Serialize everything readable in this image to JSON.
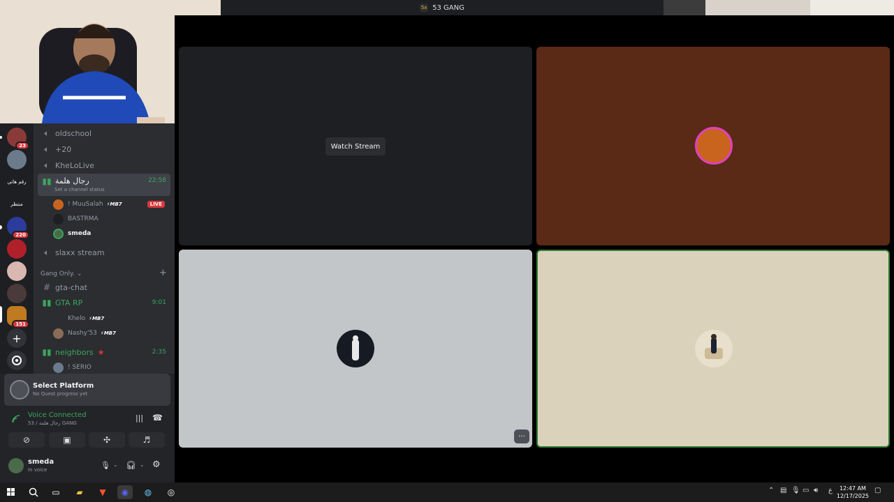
{
  "window": {
    "title": "53 GANG",
    "server_abbr": "5x"
  },
  "server_rail": {
    "items": [
      {
        "name": "server-1",
        "badge": "23",
        "color": "#8b3a3a"
      },
      {
        "name": "server-2",
        "badge": "",
        "color": "#6b7b8c"
      },
      {
        "name": "server-3",
        "label": "رقم هاتي",
        "badge": "",
        "color": "#1e1f22"
      },
      {
        "name": "server-4",
        "label": "منتظر",
        "badge": "",
        "color": "#1e1f22"
      },
      {
        "name": "server-5",
        "badge": "220",
        "color": "#2c3c9c"
      },
      {
        "name": "server-6",
        "badge": "",
        "color": "#b0202a"
      },
      {
        "name": "server-7",
        "badge": "",
        "color": "#d8b8b0"
      },
      {
        "name": "server-8",
        "badge": "",
        "color": "#4a3a3a"
      },
      {
        "name": "server-9",
        "badge": "151",
        "color": "#c07a20"
      }
    ]
  },
  "channels": {
    "voice": [
      {
        "name": "oldschool"
      },
      {
        "name": "+20"
      },
      {
        "name": "KheLoLive"
      }
    ],
    "active": {
      "name": "رجال هلمة",
      "time": "22:58",
      "status": "Set a channel status"
    },
    "members": [
      {
        "name": "! MuuSalah",
        "tag": "⚡MB7",
        "live": "LIVE"
      },
      {
        "name": "BASTRMA",
        "tag": "",
        "live": ""
      },
      {
        "name": "smeda",
        "tag": "",
        "live": ""
      }
    ],
    "slaxx": "slaxx stream",
    "category": "Gang Only.",
    "text_channel": "gta-chat",
    "gta": {
      "name": "GTA RP",
      "time": "9:01"
    },
    "gta_members": [
      {
        "name": "Khelo",
        "tag": "⚡MB7"
      },
      {
        "name": "Nashy'53",
        "tag": "⚡MB7"
      }
    ],
    "neighbors": {
      "name": "neighbors",
      "time": "2:35"
    },
    "neighbors_members": [
      {
        "name": "! SERIO"
      }
    ]
  },
  "quest": {
    "title": "Select Platform",
    "subtitle": "No Quest progress yet"
  },
  "voice": {
    "status": "Voice Connected",
    "location": "53 / رجال هلمة GANG"
  },
  "user": {
    "name": "smeda",
    "status": "In voice"
  },
  "stage": {
    "watch_label": "Watch Stream",
    "more_label": "···"
  },
  "taskbar": {
    "time": "12:47 AM",
    "date": "12/17/2025",
    "lang": "ع"
  }
}
